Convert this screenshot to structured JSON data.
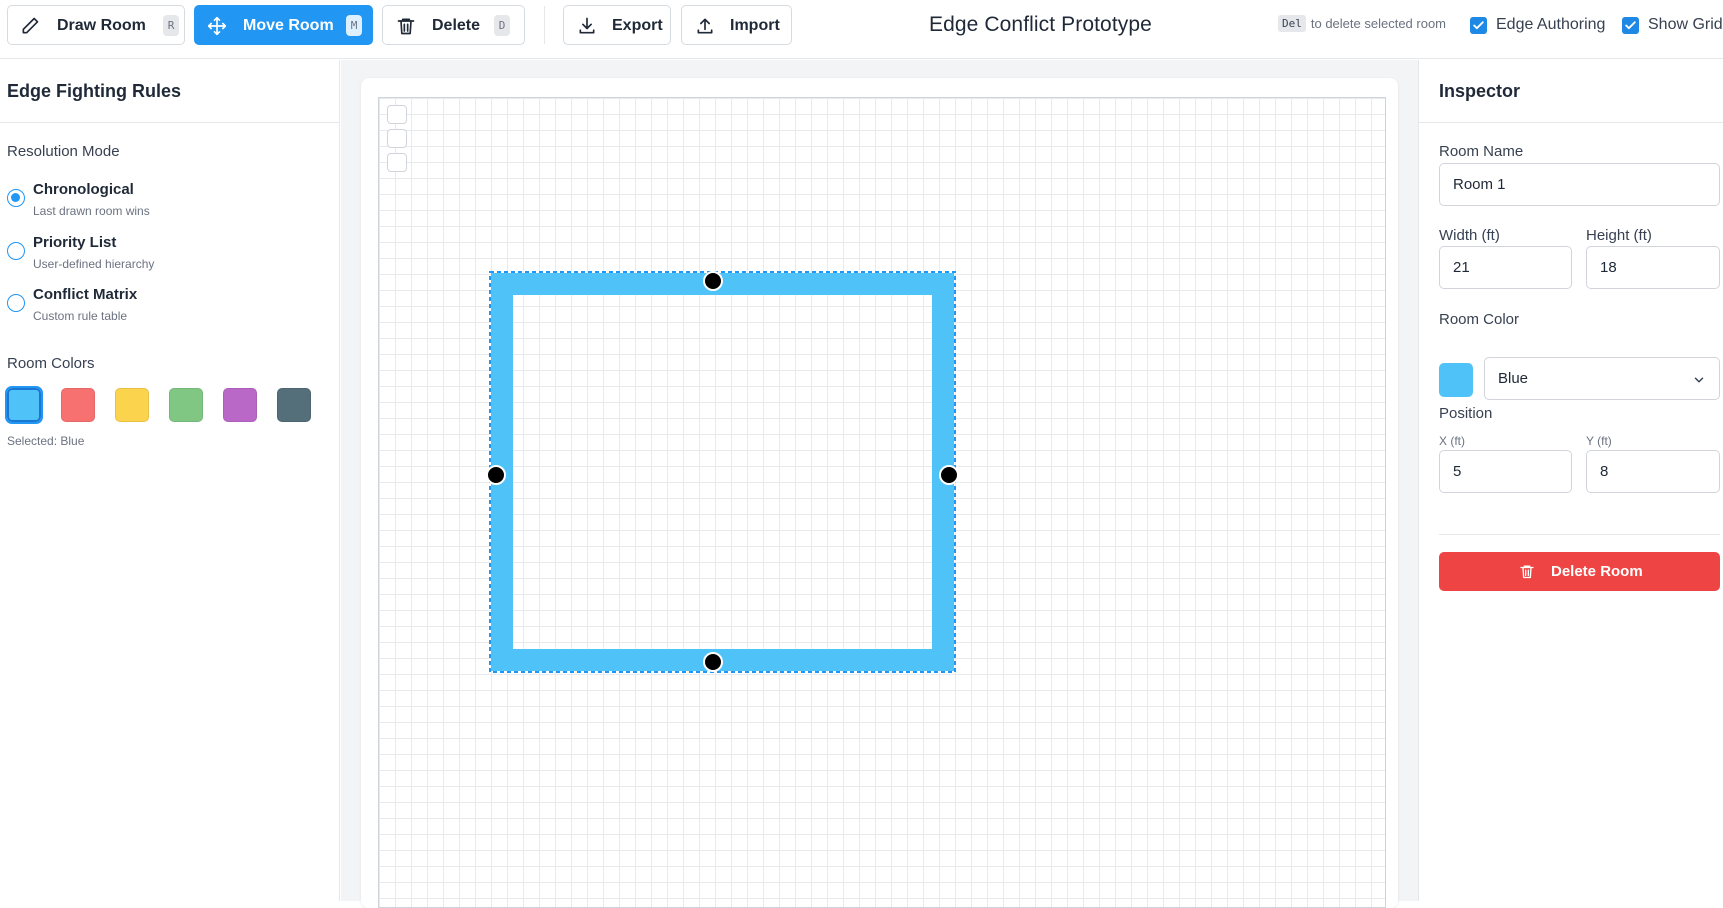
{
  "toolbar": {
    "draw": {
      "label": "Draw Room",
      "key": "R",
      "icon": "pencil-icon"
    },
    "move": {
      "label": "Move Room",
      "key": "M",
      "icon": "move-icon"
    },
    "delete": {
      "label": "Delete",
      "key": "D",
      "icon": "trash-icon"
    },
    "export": {
      "label": "Export",
      "icon": "download-icon"
    },
    "import": {
      "label": "Import",
      "icon": "upload-icon"
    },
    "title": "Edge Conflict Prototype",
    "hint_key": "Del",
    "hint_text": "to delete selected room",
    "edge_authoring": {
      "label": "Edge Authoring",
      "checked": true
    },
    "show_grid": {
      "label": "Show Grid",
      "checked": true
    },
    "accent": "#2196f3"
  },
  "left": {
    "title": "Edge Fighting Rules",
    "resolution_label": "Resolution Mode",
    "modes": [
      {
        "title": "Chronological",
        "sub": "Last drawn room wins",
        "selected": true
      },
      {
        "title": "Priority List",
        "sub": "User-defined hierarchy",
        "selected": false
      },
      {
        "title": "Conflict Matrix",
        "sub": "Custom rule table",
        "selected": false
      }
    ],
    "colors_label": "Room Colors",
    "colors": [
      "#4fc3f7",
      "#f87171",
      "#fcd34d",
      "#81c784",
      "#ba68c8",
      "#546e7a"
    ],
    "selected_text": "Selected: Blue"
  },
  "canvas": {
    "room": {
      "name": "Room 1",
      "color": "#4fc3f7",
      "selected": true
    }
  },
  "inspector": {
    "title": "Inspector",
    "room_name_label": "Room Name",
    "room_name": "Room 1",
    "width_label": "Width (ft)",
    "width": "21",
    "height_label": "Height (ft)",
    "height": "18",
    "color_label": "Room Color",
    "color_value": "Blue",
    "color_hex": "#4fc3f7",
    "position_label": "Position",
    "x_label": "X (ft)",
    "x": "5",
    "y_label": "Y (ft)",
    "y": "8",
    "delete_label": "Delete Room",
    "delete_color": "#ef4444"
  }
}
